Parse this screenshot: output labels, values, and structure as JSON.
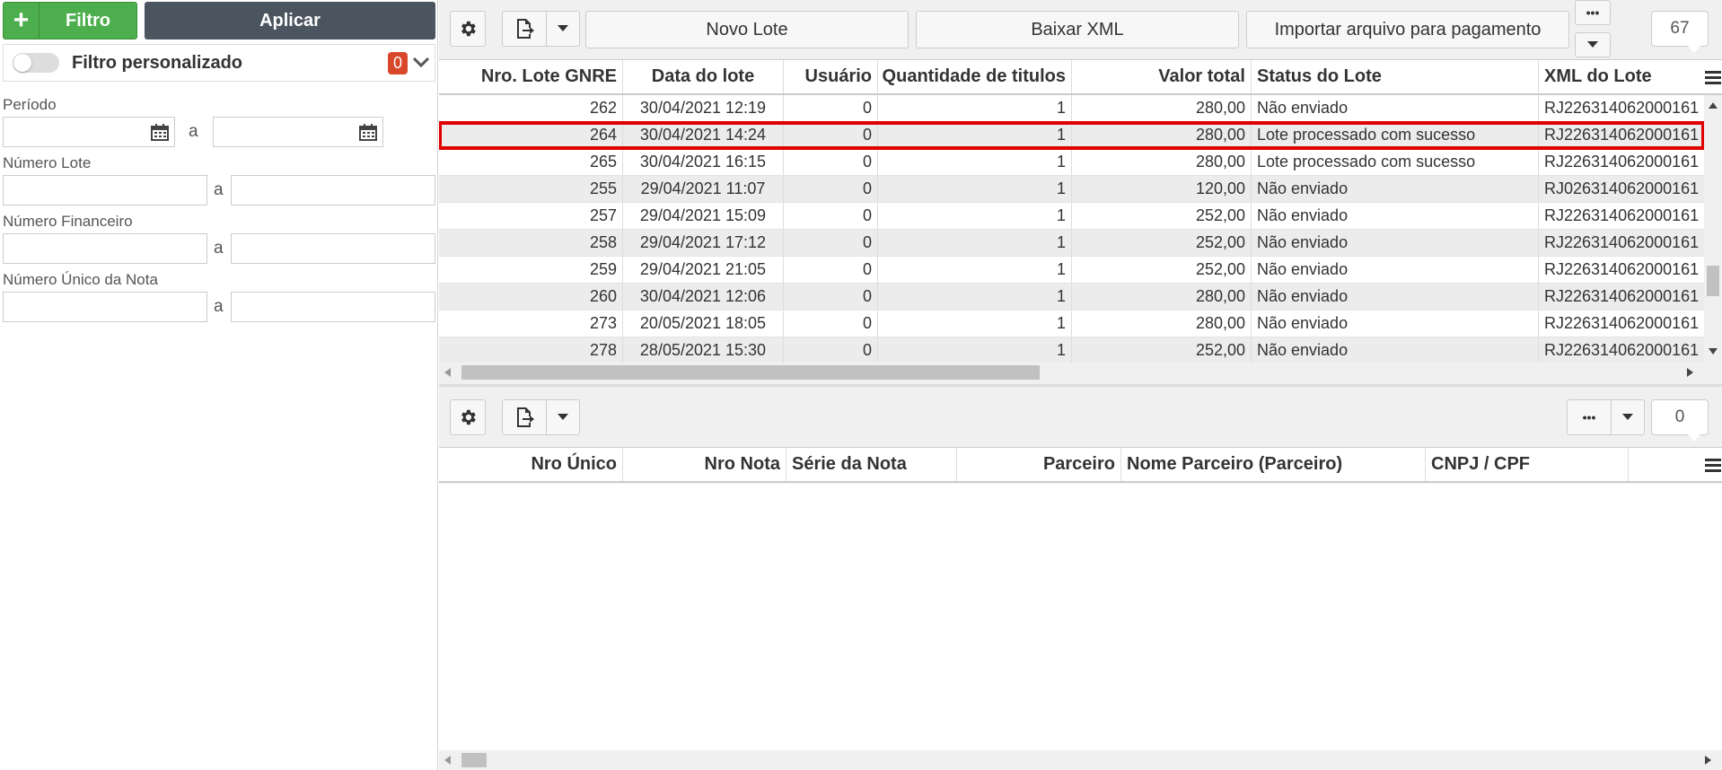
{
  "filter": {
    "filtro_label": "Filtro",
    "aplicar_label": "Aplicar",
    "custom_label": "Filtro personalizado",
    "custom_count": "0",
    "periodo_label": "Período",
    "numero_lote_label": "Número Lote",
    "numero_financeiro_label": "Número Financeiro",
    "numero_unico_label": "Número Único da Nota",
    "range_sep": "a"
  },
  "toolbar": {
    "novo_lote": "Novo Lote",
    "baixar_xml": "Baixar XML",
    "importar": "Importar arquivo para pagamento",
    "more": "•••",
    "count": "67"
  },
  "lotes_grid": {
    "columns": [
      "Nro. Lote GNRE",
      "Data do lote",
      "Usuário",
      "Quantidade de titulos",
      "Valor total",
      "Status do Lote",
      "XML do Lote"
    ],
    "rows": [
      [
        "262",
        "30/04/2021 12:19",
        "0",
        "1",
        "280,00",
        "Não enviado",
        "RJ226314062000161"
      ],
      [
        "264",
        "30/04/2021 14:24",
        "0",
        "1",
        "280,00",
        "Lote processado com sucesso",
        "RJ226314062000161"
      ],
      [
        "265",
        "30/04/2021 16:15",
        "0",
        "1",
        "280,00",
        "Lote processado com sucesso",
        "RJ226314062000161"
      ],
      [
        "255",
        "29/04/2021 11:07",
        "0",
        "1",
        "120,00",
        "Não enviado",
        "RJ026314062000161"
      ],
      [
        "257",
        "29/04/2021 15:09",
        "0",
        "1",
        "252,00",
        "Não enviado",
        "RJ226314062000161"
      ],
      [
        "258",
        "29/04/2021 17:12",
        "0",
        "1",
        "252,00",
        "Não enviado",
        "RJ226314062000161"
      ],
      [
        "259",
        "29/04/2021 21:05",
        "0",
        "1",
        "252,00",
        "Não enviado",
        "RJ226314062000161"
      ],
      [
        "260",
        "30/04/2021 12:06",
        "0",
        "1",
        "280,00",
        "Não enviado",
        "RJ226314062000161"
      ],
      [
        "273",
        "20/05/2021 18:05",
        "0",
        "1",
        "280,00",
        "Não enviado",
        "RJ226314062000161"
      ],
      [
        "278",
        "28/05/2021 15:30",
        "0",
        "1",
        "252,00",
        "Não enviado",
        "RJ226314062000161"
      ]
    ],
    "selected_row": 1
  },
  "bottom_toolbar": {
    "more": "•••",
    "count": "0"
  },
  "notas_grid": {
    "columns": [
      "Nro Único",
      "Nro Nota",
      "Série da Nota",
      "Parceiro",
      "Nome Parceiro (Parceiro)",
      "CNPJ / CPF"
    ]
  },
  "colors": {
    "filtro_green": "#4cae4c",
    "aplicar_dark": "#4a5560",
    "badge_red": "#d9472b",
    "selection_red": "#e00000"
  }
}
